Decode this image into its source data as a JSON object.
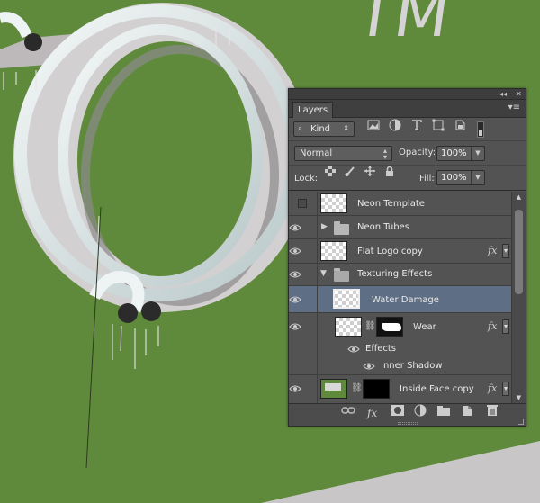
{
  "panel": {
    "tab_label": "Layers",
    "filter": {
      "search_icon": "magnifier-icon",
      "kind_label": "Kind",
      "icons": [
        "image-filter-icon",
        "adjustment-filter-icon",
        "type-filter-icon",
        "shape-filter-icon",
        "smart-object-filter-icon"
      ]
    },
    "blend_mode": "Normal",
    "opacity_label": "Opacity:",
    "opacity_value": "100%",
    "lock_label": "Lock:",
    "fill_label": "Fill:",
    "fill_value": "100%",
    "layers": [
      {
        "name": "Neon Template",
        "visible": false,
        "type": "layer"
      },
      {
        "name": "Neon Tubes",
        "visible": true,
        "type": "group",
        "expanded": false
      },
      {
        "name": "Flat Logo copy",
        "visible": true,
        "type": "smart-object",
        "fx": "fx"
      },
      {
        "name": "Texturing Effects",
        "visible": true,
        "type": "group",
        "expanded": true
      },
      {
        "name": "Water Damage",
        "visible": true,
        "type": "layer",
        "selected": true
      },
      {
        "name": "Wear",
        "visible": true,
        "type": "masked-layer",
        "fx": "fx"
      },
      {
        "name": "Effects",
        "visible": true,
        "type": "effects-header"
      },
      {
        "name": "Inner Shadow",
        "visible": true,
        "type": "effect"
      },
      {
        "name": "Inside Face copy",
        "visible": true,
        "type": "smart-object-masked",
        "fx": "fx"
      }
    ],
    "bottom_icons": [
      "link-layers-icon",
      "fx-icon",
      "add-mask-icon",
      "adjustment-layer-icon",
      "new-group-icon",
      "new-layer-icon",
      "trash-icon"
    ]
  },
  "canvas": {
    "background_color": "#5f8a3b",
    "text_fragment": "TM"
  }
}
